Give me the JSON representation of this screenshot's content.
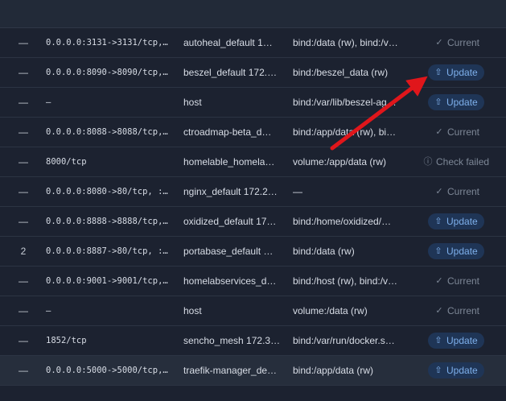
{
  "rows": [
    {
      "count": "—",
      "ports": "0.0.0.0:3131->3131/tcp,…",
      "network": "autoheal_default 1…",
      "volumes": "bind:/data (rw), bind:/v…",
      "status": "Current",
      "status_type": "current",
      "status_icon": "check-icon"
    },
    {
      "count": "—",
      "ports": "0.0.0.0:8090->8090/tcp,…",
      "network": "beszel_default 172.…",
      "volumes": "bind:/beszel_data (rw)",
      "status": "Update",
      "status_type": "update",
      "status_icon": "upload-icon"
    },
    {
      "count": "—",
      "ports": "–",
      "network": "host",
      "volumes": "bind:/var/lib/beszel-ag…",
      "status": "Update",
      "status_type": "update",
      "status_icon": "upload-icon"
    },
    {
      "count": "—",
      "ports": "0.0.0.0:8088->8088/tcp,…",
      "network": "ctroadmap-beta_d…",
      "volumes": "bind:/app/data (rw), bi…",
      "status": "Current",
      "status_type": "current",
      "status_icon": "check-icon"
    },
    {
      "count": "—",
      "ports": "8000/tcp",
      "network": "homelable_homela…",
      "volumes": "volume:/app/data (rw)",
      "status": "Check failed",
      "status_type": "failed",
      "status_icon": "info-circle-icon"
    },
    {
      "count": "—",
      "ports": "0.0.0.0:8080->80/tcp, :…",
      "network": "nginx_default 172.2…",
      "volumes": "—",
      "status": "Current",
      "status_type": "current",
      "status_icon": "check-icon"
    },
    {
      "count": "—",
      "ports": "0.0.0.0:8888->8888/tcp,…",
      "network": "oxidized_default 17…",
      "volumes": "bind:/home/oxidized/…",
      "status": "Update",
      "status_type": "update",
      "status_icon": "upload-icon"
    },
    {
      "count": "2",
      "ports": "0.0.0.0:8887->80/tcp, :…",
      "network": "portabase_default …",
      "volumes": "bind:/data (rw)",
      "status": "Update",
      "status_type": "update",
      "status_icon": "upload-icon"
    },
    {
      "count": "—",
      "ports": "0.0.0.0:9001->9001/tcp,…",
      "network": "homelabservices_d…",
      "volumes": "bind:/host (rw), bind:/v…",
      "status": "Current",
      "status_type": "current",
      "status_icon": "check-icon"
    },
    {
      "count": "—",
      "ports": "–",
      "network": "host",
      "volumes": "volume:/data (rw)",
      "status": "Current",
      "status_type": "current",
      "status_icon": "check-icon"
    },
    {
      "count": "—",
      "ports": "1852/tcp",
      "network": "sencho_mesh 172.3…",
      "volumes": "bind:/var/run/docker.s…",
      "status": "Update",
      "status_type": "update",
      "status_icon": "upload-icon"
    },
    {
      "count": "—",
      "ports": "0.0.0.0:5000->5000/tcp,…",
      "network": "traefik-manager_de…",
      "volumes": "bind:/app/data (rw)",
      "status": "Update",
      "status_type": "update",
      "status_icon": "upload-icon"
    }
  ],
  "icons": {
    "check-icon": "✓",
    "upload-icon": "⇧",
    "info-circle-icon": "ⓘ"
  },
  "colors": {
    "background": "#1c2230",
    "update_badge_bg": "#1f3556",
    "update_text": "#7eb0ec",
    "muted_text": "#7d8796",
    "annotation_arrow": "#e0161b"
  }
}
